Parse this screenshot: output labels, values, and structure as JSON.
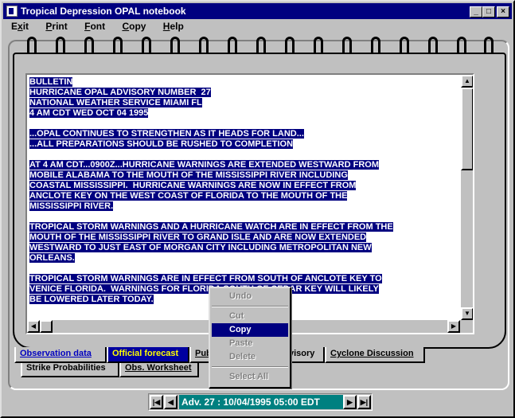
{
  "window": {
    "title": "Tropical Depression OPAL notebook",
    "minimize": "_",
    "maximize": "□",
    "close": "×"
  },
  "menu": {
    "exit_u": "x",
    "exit_a": "E",
    "exit_b": "it",
    "print_u": "P",
    "print_b": "rint",
    "font_u": "F",
    "font_b": "ont",
    "copy_u": "C",
    "copy_b": "opy",
    "help_u": "H",
    "help_b": "elp"
  },
  "advisory_text": [
    "BULLETIN",
    "HURRICANE OPAL ADVISORY NUMBER  27",
    "NATIONAL WEATHER SERVICE MIAMI FL",
    "4 AM CDT WED OCT 04 1995",
    "",
    "...OPAL CONTINUES TO STRENGTHEN AS IT HEADS FOR LAND...",
    "...ALL PREPARATIONS SHOULD BE RUSHED TO COMPLETION",
    "",
    "AT 4 AM CDT...0900Z...HURRICANE WARNINGS ARE EXTENDED WESTWARD FROM",
    "MOBILE ALABAMA TO THE MOUTH OF THE MISSISSIPPI RIVER INCLUDING",
    "COASTAL MISSISSIPPI.  HURRICANE WARNINGS ARE NOW IN EFFECT FROM",
    "ANCLOTE KEY ON THE WEST COAST OF FLORIDA TO THE MOUTH OF THE",
    "MISSISSIPPI RIVER.",
    "",
    "TROPICAL STORM WARNINGS AND A HURRICANE WATCH ARE IN EFFECT FROM THE",
    "MOUTH OF THE MISSISSIPPI RIVER TO GRAND ISLE AND ARE NOW EXTENDED",
    "WESTWARD TO JUST EAST OF MORGAN CITY INCLUDING METROPOLITAN NEW",
    "ORLEANS.",
    "",
    "TROPICAL STORM WARNINGS ARE IN EFFECT FROM SOUTH OF ANCLOTE KEY TO",
    "VENICE FLORIDA.  WARNINGS FOR FLORIDA SOUTH OF CEDAR KEY WILL LIKELY",
    "BE LOWERED LATER TODAY."
  ],
  "tabs_front": {
    "observation": "Observation data",
    "official": "Official forecast",
    "public": "Pub",
    "advisory": "visory",
    "discussion": "Cyclone Discussion"
  },
  "tabs_back": {
    "strike": "Strike Probabilities",
    "obs_worksheet": "Obs. Worksheet"
  },
  "context_menu": {
    "undo": "Undo",
    "cut": "Cut",
    "copy": "Copy",
    "paste": "Paste",
    "delete": "Delete",
    "select_all": "Select All"
  },
  "navigator": {
    "label": "Adv. 27 : 10/04/1995 05:00 EDT",
    "first": "|◀",
    "prev": "◀",
    "next": "▶",
    "last": "▶|"
  },
  "colors": {
    "title_bar": "#000080",
    "selection": "#000080",
    "observation_tab_text": "#0000c0",
    "official_tab_bg": "#0000a0",
    "official_tab_text": "#ffff00",
    "navigator_label_bg": "#008080"
  }
}
